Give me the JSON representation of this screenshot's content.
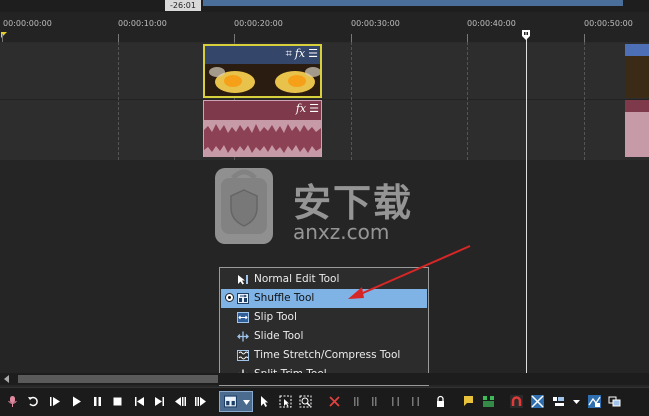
{
  "timeline": {
    "timestamp_badge": "-26:01",
    "ruler_labels": [
      "00:00:00:00",
      "00:00:10:00",
      "00:00:20:00",
      "00:00:30:00",
      "00:00:40:00",
      "00:00:50:00"
    ]
  },
  "clips": {
    "video_icons": [
      "crop-icon",
      "fx-icon",
      "menu-icon"
    ],
    "audio_icons": [
      "fx-icon",
      "menu-icon"
    ],
    "fx_label": "fx",
    "crop_glyph": "⌗",
    "menu_glyph": "☰"
  },
  "watermark": {
    "title": "安下载",
    "domain": "anxz.com",
    "badge_glyph": "安"
  },
  "edit_tool_menu": {
    "items": [
      {
        "label": "Normal Edit Tool",
        "icon": "normal-edit-icon",
        "selected": false
      },
      {
        "label": "Shuffle Tool",
        "icon": "shuffle-icon",
        "selected": true
      },
      {
        "label": "Slip Tool",
        "icon": "slip-icon",
        "selected": false
      },
      {
        "label": "Slide Tool",
        "icon": "slide-icon",
        "selected": false
      },
      {
        "label": "Time Stretch/Compress Tool",
        "icon": "time-stretch-icon",
        "selected": false
      },
      {
        "label": "Split Trim Tool",
        "icon": "split-trim-icon",
        "selected": false
      }
    ]
  },
  "colors": {
    "selection": "#7fb3e6",
    "video_clip_border": "#d8cf3c",
    "audio_clip": "#7e3a4a",
    "arrow": "#d62626"
  },
  "transport": {
    "buttons": [
      "record-icon",
      "loop-icon",
      "play-from-start-icon",
      "play-icon",
      "pause-icon",
      "stop-icon",
      "go-to-start-icon",
      "go-to-end-icon",
      "previous-frame-icon",
      "next-frame-icon",
      "edit-tool-dropdown",
      "normal-edit-icon",
      "selection-icon",
      "zoom-icon",
      "delete-icon",
      "trim-start-icon",
      "trim-end-icon",
      "lock-icon",
      "marker-icon",
      "region-icon",
      "snapping-icon",
      "auto-crossfade-icon",
      "ripple-icon",
      "lock-envelopes-icon",
      "ignore-grouping-icon"
    ]
  }
}
